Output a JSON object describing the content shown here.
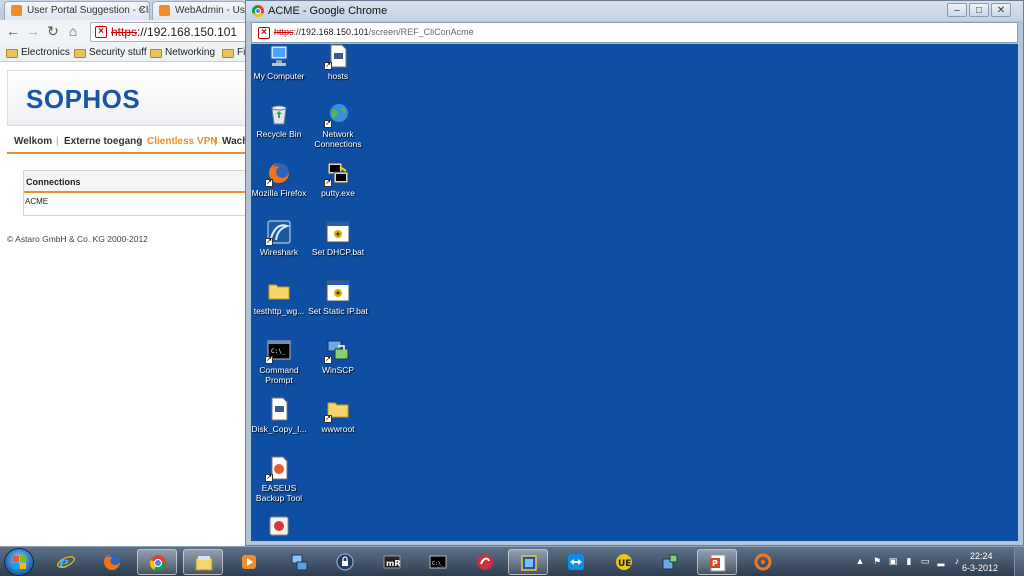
{
  "bg_browser": {
    "tabs": [
      "User Portal Suggestion - Cli",
      "WebAdmin - User"
    ],
    "address": {
      "proto": "https",
      "rest": "://192.168.150.101"
    },
    "bookmarks": [
      "Electronics",
      "Security stuff",
      "Networking",
      "Fi"
    ]
  },
  "portal": {
    "logo": "SOPHOS",
    "nav": [
      "Welkom",
      "Externe toegang",
      "Clientless VPN",
      "Wach"
    ],
    "active_nav": "Clientless VPN",
    "connections_header": "Connections",
    "connections": [
      "ACME"
    ],
    "footer": "© Astaro GmbH & Co. KG 2000-2012"
  },
  "fg_window": {
    "title": "ACME - Google Chrome",
    "address": {
      "proto": "https",
      "host": "://192.168.150.101",
      "path": "/screen/REF_CliConAcme"
    },
    "controls": {
      "minimize": "‒",
      "maximize": "□",
      "close": "✕"
    }
  },
  "desktop_icons": [
    {
      "label": "My Computer",
      "icon": "computer-icon"
    },
    {
      "label": "hosts",
      "icon": "file-icon"
    },
    {
      "label": "Recycle Bin",
      "icon": "recycle-bin-icon"
    },
    {
      "label": "Network Connections",
      "icon": "network-icon"
    },
    {
      "label": "Mozilla Firefox",
      "icon": "firefox-icon"
    },
    {
      "label": "putty.exe",
      "icon": "putty-icon"
    },
    {
      "label": "Wireshark",
      "icon": "wireshark-icon"
    },
    {
      "label": "Set DHCP.bat",
      "icon": "batch-file-icon"
    },
    {
      "label": "testhttp_wg...",
      "icon": "folder-icon"
    },
    {
      "label": "Set Static IP.bat",
      "icon": "batch-file-icon"
    },
    {
      "label": "Command Prompt",
      "icon": "cmd-icon"
    },
    {
      "label": "WinSCP",
      "icon": "winscp-icon"
    },
    {
      "label": "Disk_Copy_I...",
      "icon": "file-icon"
    },
    {
      "label": "wwwroot",
      "icon": "folder-icon"
    },
    {
      "label": "EASEUS Backup Tool",
      "icon": "easeus-icon"
    }
  ],
  "taskbar": {
    "clock_time": "22:24",
    "clock_date": "6-3-2012",
    "apps": [
      "ie-icon",
      "firefox-icon",
      "chrome-icon",
      "explorer-icon",
      "media-player-icon",
      "network-tool-icon",
      "lock-icon",
      "mremote-icon",
      "cmd-icon",
      "snagit-icon",
      "virtualbox-icon",
      "teamviewer-icon",
      "ultraedit-icon",
      "vpn-icon",
      "powerpoint-icon",
      "orange-app-icon"
    ]
  },
  "colors": {
    "desktop_blue": "#0e4ea3",
    "sophos_blue": "#1a54a4",
    "accent_orange": "#f08c2a"
  }
}
